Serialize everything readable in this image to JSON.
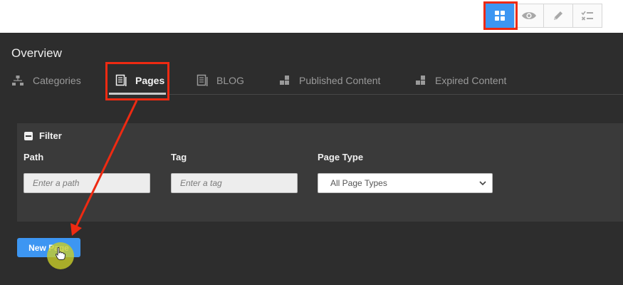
{
  "toolbar": {
    "buttons": [
      {
        "icon": "grid-icon",
        "active": true
      },
      {
        "icon": "eye-icon",
        "active": false
      },
      {
        "icon": "pencil-icon",
        "active": false
      },
      {
        "icon": "checklist-icon",
        "active": false
      }
    ]
  },
  "page": {
    "title": "Overview"
  },
  "tabs": [
    {
      "label": "Categories",
      "icon": "hierarchy-icon",
      "active": false
    },
    {
      "label": "Pages",
      "icon": "document-icon",
      "active": true
    },
    {
      "label": "BLOG",
      "icon": "document-icon",
      "active": false
    },
    {
      "label": "Published Content",
      "icon": "blocks-icon",
      "active": false
    },
    {
      "label": "Expired Content",
      "icon": "blocks-icon",
      "active": false
    }
  ],
  "filter": {
    "title": "Filter",
    "path": {
      "label": "Path",
      "placeholder": "Enter a path"
    },
    "tag": {
      "label": "Tag",
      "placeholder": "Enter a tag"
    },
    "page_type": {
      "label": "Page Type",
      "selected": "All Page Types"
    }
  },
  "new_page_button": {
    "label": "New Page"
  },
  "colors": {
    "accent": "#3d96f2",
    "annotation": "#ee2a12",
    "background": "#2d2d2d",
    "panel": "#3a3a3a",
    "cursor_halo": "#c8cd28"
  }
}
